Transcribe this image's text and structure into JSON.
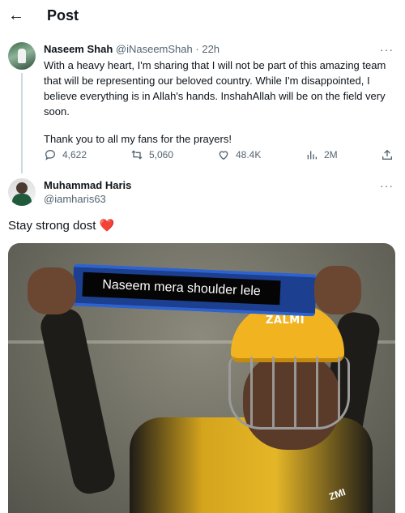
{
  "header": {
    "title": "Post",
    "back_icon": "arrow-left-icon"
  },
  "tweet": {
    "author_name": "Naseem Shah",
    "handle": "@iNaseemShah",
    "separator": "·",
    "time": "22h",
    "more": "···",
    "paragraphs": [
      "With a heavy heart, I'm sharing that I will not be part of this amazing team that will be representing our beloved country. While I'm disappointed, I believe everything is in Allah's hands. InshahAllah will be on the field very soon.",
      "Thank you to all my fans for the prayers!"
    ],
    "actions": {
      "replies": "4,622",
      "retweets": "5,060",
      "likes": "48.4K",
      "views": "2M"
    }
  },
  "reply": {
    "author_name": "Muhammad Haris",
    "handle": "@iamharis63",
    "more": "···",
    "text": "Stay strong dost",
    "emoji": "❤️"
  },
  "media": {
    "caption": "Naseem mera shoulder lele",
    "helmet_text": "ZALMI",
    "corner_text": "ZMI"
  },
  "colors": {
    "text": "#0f1419",
    "muted": "#536471",
    "thread_line": "#cfd9de",
    "heart": "#e0245e"
  }
}
